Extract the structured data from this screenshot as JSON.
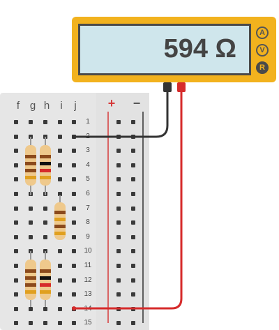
{
  "multimeter": {
    "reading": "594 Ω",
    "modes": [
      {
        "label": "A",
        "active": false
      },
      {
        "label": "V",
        "active": false
      },
      {
        "label": "R",
        "active": true
      }
    ]
  },
  "breadboard": {
    "columns": [
      "f",
      "g",
      "h",
      "i",
      "j"
    ],
    "rails": [
      {
        "label": "+",
        "color": "#d63a3a"
      },
      {
        "label": "−",
        "color": "#555555"
      }
    ],
    "rows": [
      "1",
      "2",
      "3",
      "4",
      "5",
      "6",
      "7",
      "8",
      "9",
      "10",
      "11",
      "12",
      "13",
      "14",
      "15"
    ]
  },
  "wires": {
    "black_color": "#333333",
    "red_color": "#d62b2b"
  }
}
